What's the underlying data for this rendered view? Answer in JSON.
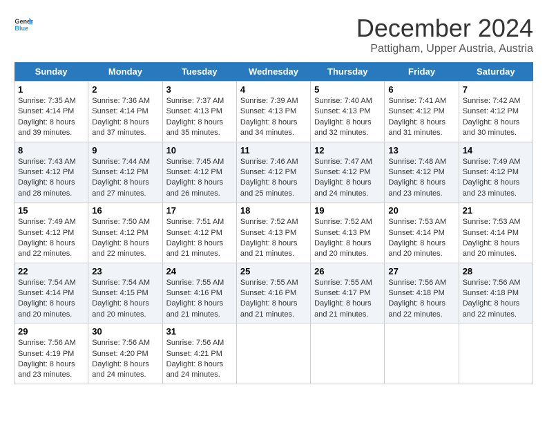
{
  "header": {
    "logo_general": "General",
    "logo_blue": "Blue",
    "month_year": "December 2024",
    "location": "Pattigham, Upper Austria, Austria"
  },
  "weekdays": [
    "Sunday",
    "Monday",
    "Tuesday",
    "Wednesday",
    "Thursday",
    "Friday",
    "Saturday"
  ],
  "weeks": [
    [
      {
        "day": "1",
        "sunrise": "7:35 AM",
        "sunset": "4:14 PM",
        "daylight": "8 hours and 39 minutes."
      },
      {
        "day": "2",
        "sunrise": "7:36 AM",
        "sunset": "4:14 PM",
        "daylight": "8 hours and 37 minutes."
      },
      {
        "day": "3",
        "sunrise": "7:37 AM",
        "sunset": "4:13 PM",
        "daylight": "8 hours and 35 minutes."
      },
      {
        "day": "4",
        "sunrise": "7:39 AM",
        "sunset": "4:13 PM",
        "daylight": "8 hours and 34 minutes."
      },
      {
        "day": "5",
        "sunrise": "7:40 AM",
        "sunset": "4:13 PM",
        "daylight": "8 hours and 32 minutes."
      },
      {
        "day": "6",
        "sunrise": "7:41 AM",
        "sunset": "4:12 PM",
        "daylight": "8 hours and 31 minutes."
      },
      {
        "day": "7",
        "sunrise": "7:42 AM",
        "sunset": "4:12 PM",
        "daylight": "8 hours and 30 minutes."
      }
    ],
    [
      {
        "day": "8",
        "sunrise": "7:43 AM",
        "sunset": "4:12 PM",
        "daylight": "8 hours and 28 minutes."
      },
      {
        "day": "9",
        "sunrise": "7:44 AM",
        "sunset": "4:12 PM",
        "daylight": "8 hours and 27 minutes."
      },
      {
        "day": "10",
        "sunrise": "7:45 AM",
        "sunset": "4:12 PM",
        "daylight": "8 hours and 26 minutes."
      },
      {
        "day": "11",
        "sunrise": "7:46 AM",
        "sunset": "4:12 PM",
        "daylight": "8 hours and 25 minutes."
      },
      {
        "day": "12",
        "sunrise": "7:47 AM",
        "sunset": "4:12 PM",
        "daylight": "8 hours and 24 minutes."
      },
      {
        "day": "13",
        "sunrise": "7:48 AM",
        "sunset": "4:12 PM",
        "daylight": "8 hours and 23 minutes."
      },
      {
        "day": "14",
        "sunrise": "7:49 AM",
        "sunset": "4:12 PM",
        "daylight": "8 hours and 23 minutes."
      }
    ],
    [
      {
        "day": "15",
        "sunrise": "7:49 AM",
        "sunset": "4:12 PM",
        "daylight": "8 hours and 22 minutes."
      },
      {
        "day": "16",
        "sunrise": "7:50 AM",
        "sunset": "4:12 PM",
        "daylight": "8 hours and 22 minutes."
      },
      {
        "day": "17",
        "sunrise": "7:51 AM",
        "sunset": "4:12 PM",
        "daylight": "8 hours and 21 minutes."
      },
      {
        "day": "18",
        "sunrise": "7:52 AM",
        "sunset": "4:13 PM",
        "daylight": "8 hours and 21 minutes."
      },
      {
        "day": "19",
        "sunrise": "7:52 AM",
        "sunset": "4:13 PM",
        "daylight": "8 hours and 20 minutes."
      },
      {
        "day": "20",
        "sunrise": "7:53 AM",
        "sunset": "4:14 PM",
        "daylight": "8 hours and 20 minutes."
      },
      {
        "day": "21",
        "sunrise": "7:53 AM",
        "sunset": "4:14 PM",
        "daylight": "8 hours and 20 minutes."
      }
    ],
    [
      {
        "day": "22",
        "sunrise": "7:54 AM",
        "sunset": "4:14 PM",
        "daylight": "8 hours and 20 minutes."
      },
      {
        "day": "23",
        "sunrise": "7:54 AM",
        "sunset": "4:15 PM",
        "daylight": "8 hours and 20 minutes."
      },
      {
        "day": "24",
        "sunrise": "7:55 AM",
        "sunset": "4:16 PM",
        "daylight": "8 hours and 21 minutes."
      },
      {
        "day": "25",
        "sunrise": "7:55 AM",
        "sunset": "4:16 PM",
        "daylight": "8 hours and 21 minutes."
      },
      {
        "day": "26",
        "sunrise": "7:55 AM",
        "sunset": "4:17 PM",
        "daylight": "8 hours and 21 minutes."
      },
      {
        "day": "27",
        "sunrise": "7:56 AM",
        "sunset": "4:18 PM",
        "daylight": "8 hours and 22 minutes."
      },
      {
        "day": "28",
        "sunrise": "7:56 AM",
        "sunset": "4:18 PM",
        "daylight": "8 hours and 22 minutes."
      }
    ],
    [
      {
        "day": "29",
        "sunrise": "7:56 AM",
        "sunset": "4:19 PM",
        "daylight": "8 hours and 23 minutes."
      },
      {
        "day": "30",
        "sunrise": "7:56 AM",
        "sunset": "4:20 PM",
        "daylight": "8 hours and 24 minutes."
      },
      {
        "day": "31",
        "sunrise": "7:56 AM",
        "sunset": "4:21 PM",
        "daylight": "8 hours and 24 minutes."
      },
      null,
      null,
      null,
      null
    ]
  ]
}
